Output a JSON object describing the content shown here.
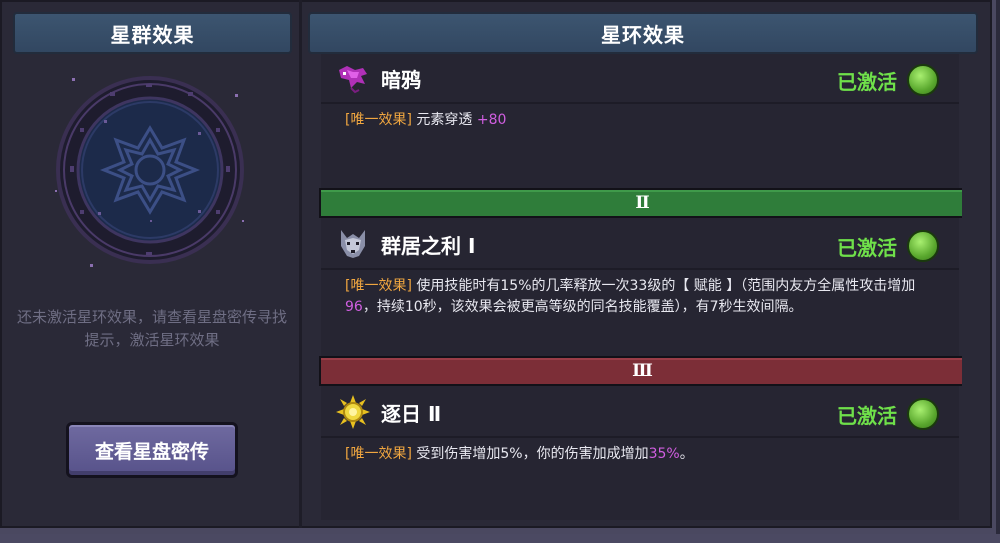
{
  "left_panel": {
    "title": "星群效果",
    "hint": "还未激活星环效果，请查看星盘密传寻找提示，激活星环效果",
    "button_label": "查看星盘密传"
  },
  "right_panel": {
    "title": "星环效果",
    "cards": [
      {
        "name": "暗鸦",
        "status": "已激活",
        "icon": "crow-icon",
        "tag": "[唯一效果]",
        "text_before": " 元素穿透 ",
        "highlight": "+80",
        "text_after": ""
      },
      {
        "name": "群居之利 Ⅰ",
        "status": "已激活",
        "icon": "wolf-icon",
        "tag": "[唯一效果]",
        "text_before": " 使用技能时有15%的几率释放一次33级的【 赋能 】（范围内友方全属性攻击增加",
        "highlight": "96",
        "text_after": "，持续10秒，该效果会被更高等级的同名技能覆盖），有7秒生效间隔。"
      },
      {
        "name": "逐日 Ⅱ",
        "status": "已激活",
        "icon": "sun-icon",
        "tag": "[唯一效果]",
        "text_before": " 受到伤害增加5%，你的伤害加成增加",
        "highlight": "35%",
        "text_after": "。"
      }
    ],
    "tiers": [
      "Ⅱ",
      "Ⅲ"
    ]
  },
  "colors": {
    "active_green": "#6fe04a",
    "tag_orange": "#f0a640",
    "highlight_purple": "#d05ee0",
    "tier2_green": "#2f7d3a",
    "tier3_red": "#7c2e37"
  }
}
